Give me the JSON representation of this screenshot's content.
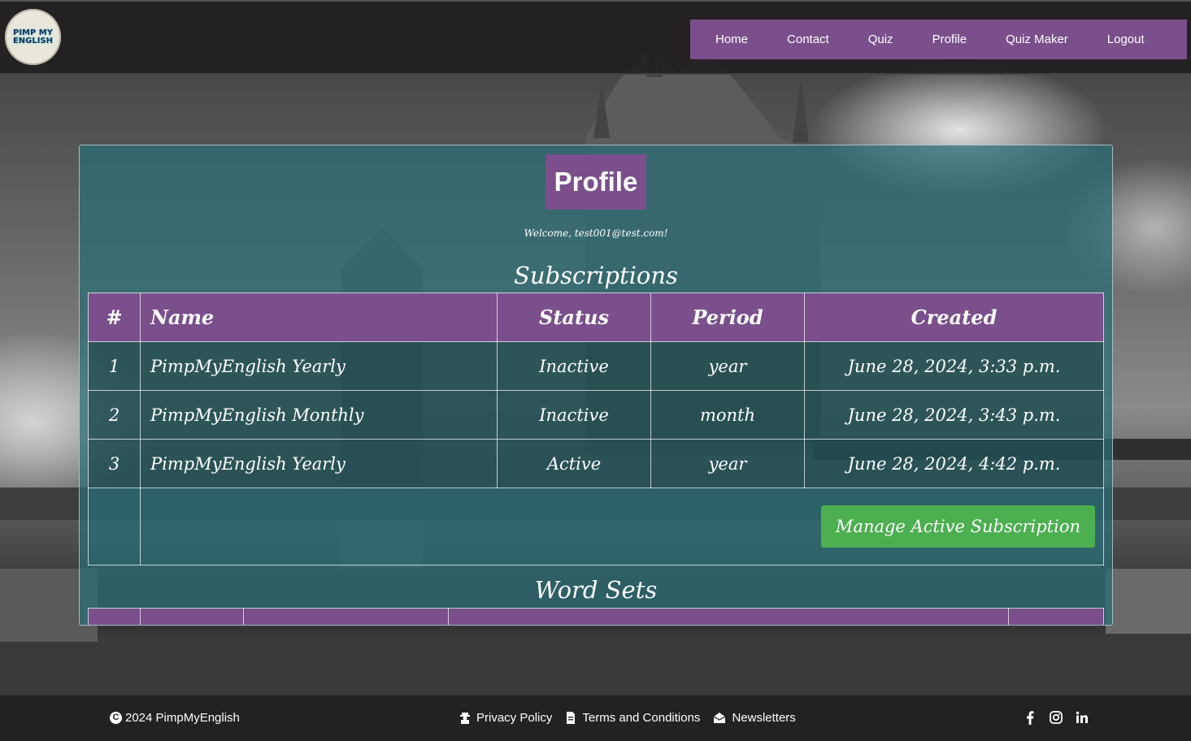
{
  "brand": {
    "logo_text": "PIMP MY ENGLISH"
  },
  "nav": {
    "items": [
      {
        "label": "Home"
      },
      {
        "label": "Contact"
      },
      {
        "label": "Quiz"
      },
      {
        "label": "Profile"
      },
      {
        "label": "Quiz Maker"
      },
      {
        "label": "Logout"
      }
    ]
  },
  "profile": {
    "title": "Profile",
    "welcome": "Welcome, test001@test.com!"
  },
  "subscriptions": {
    "title": "Subscriptions",
    "columns": [
      "#",
      "Name",
      "Status",
      "Period",
      "Created"
    ],
    "rows": [
      {
        "num": "1",
        "name": "PimpMyEnglish Yearly",
        "status": "Inactive",
        "period": "year",
        "created": "June 28, 2024, 3:33 p.m."
      },
      {
        "num": "2",
        "name": "PimpMyEnglish Monthly",
        "status": "Inactive",
        "period": "month",
        "created": "June 28, 2024, 3:43 p.m."
      },
      {
        "num": "3",
        "name": "PimpMyEnglish Yearly",
        "status": "Active",
        "period": "year",
        "created": "June 28, 2024, 4:42 p.m."
      }
    ],
    "manage_label": "Manage Active Subscription"
  },
  "word_sets": {
    "title": "Word Sets"
  },
  "footer": {
    "copyright": "2024 PimpMyEnglish",
    "links": [
      {
        "label": "Privacy Policy",
        "icon": "user-secret-icon"
      },
      {
        "label": "Terms and Conditions",
        "icon": "file-icon"
      },
      {
        "label": "Newsletters",
        "icon": "envelope-open-icon"
      }
    ],
    "social": [
      "facebook-icon",
      "instagram-icon",
      "linkedin-icon"
    ]
  },
  "colors": {
    "accent_purple": "#7a4f8c",
    "panel_teal": "#286e76",
    "button_green": "#4caf50"
  }
}
